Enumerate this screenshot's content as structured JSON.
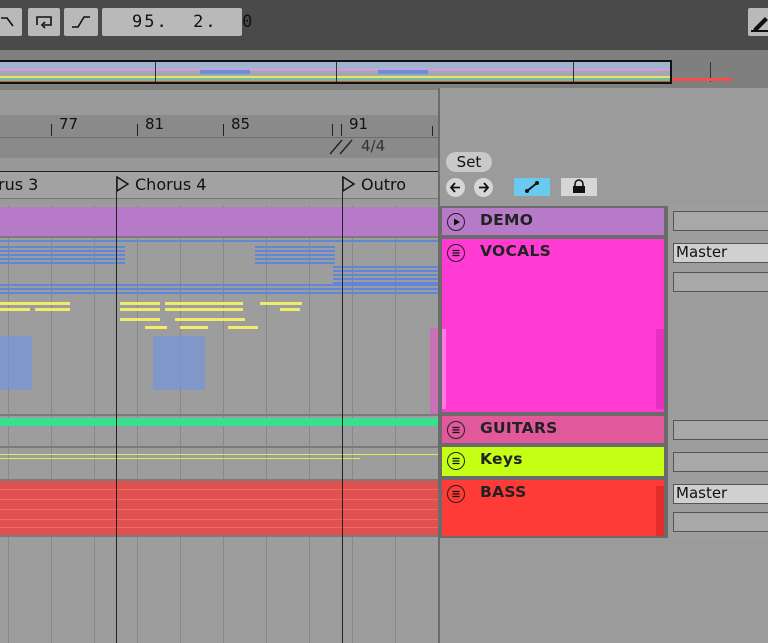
{
  "toolbar": {
    "position": "95.  2.  0",
    "buttons": [
      "curve-icon",
      "loop-icon",
      "punch-icon"
    ],
    "pencil_icon": "pencil-icon"
  },
  "ruler": {
    "bars": [
      "77",
      "81",
      "85",
      "91"
    ],
    "time_signature": "4/4"
  },
  "locators": {
    "items": [
      {
        "label": "rus 3"
      },
      {
        "label": "Chorus 4"
      },
      {
        "label": "Outro"
      }
    ],
    "set_label": "Set"
  },
  "tracks": [
    {
      "name": "DEMO",
      "color": "#b77ac9",
      "icon": "play-icon"
    },
    {
      "name": "VOCALS",
      "color": "#ff3bd4",
      "icon": "group-icon",
      "output": "Master"
    },
    {
      "name": "GUITARS",
      "color": "#e1589b",
      "icon": "group-icon"
    },
    {
      "name": "Keys",
      "color": "#c4ff15",
      "icon": "group-icon"
    },
    {
      "name": "BASS",
      "color": "#ff3b38",
      "icon": "group-icon",
      "output": "Master"
    }
  ],
  "colors": {
    "automation_active": "#69c9ef",
    "clip_blue": "#5f86d8",
    "clip_yellow": "#f0eb6a",
    "guitar_line": "#37e08e"
  }
}
